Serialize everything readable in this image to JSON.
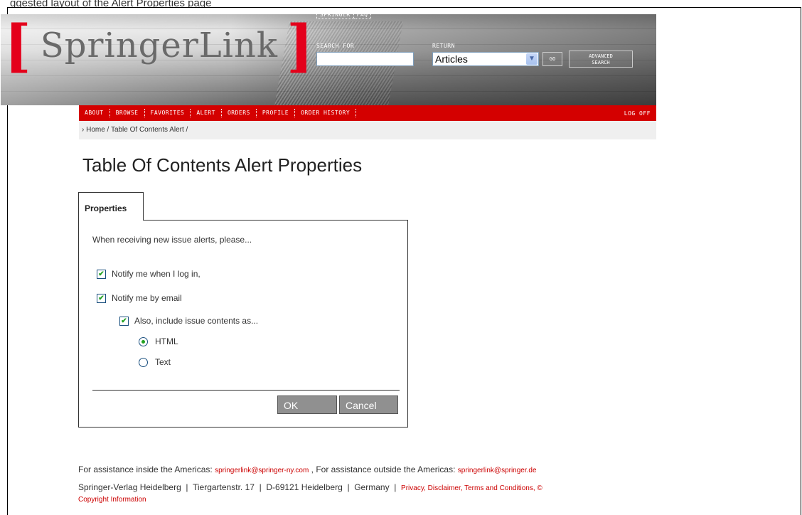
{
  "caption_fragment": "ggested layout of the Alert Properties page",
  "header": {
    "logo_text": "SpringerLink",
    "top_links": [
      "SPRINGER",
      "FAQ"
    ],
    "search_label": "SEARCH FOR",
    "search_value": "",
    "return_label": "RETURN",
    "return_selected": "Articles",
    "go_label": "GO",
    "advanced_line1": "ADVANCED",
    "advanced_line2": "SEARCH"
  },
  "nav": {
    "items": [
      "ABOUT",
      "BROWSE",
      "FAVORITES",
      "ALERT",
      "ORDERS",
      "PROFILE",
      "ORDER HISTORY"
    ],
    "logoff": "LOG OFF"
  },
  "breadcrumb": "› Home / Table Of Contents Alert /",
  "page_title": "Table Of Contents Alert Properties",
  "tab_label": "Properties",
  "form": {
    "intro": "When receiving new issue alerts, please...",
    "notify_login": "Notify me when I log in,",
    "notify_email": "Notify me by email",
    "include_contents": "Also, include issue contents as...",
    "format_html": "HTML",
    "format_text": "Text",
    "ok_label": "OK",
    "cancel_label": "Cancel",
    "notify_login_checked": true,
    "notify_email_checked": true,
    "include_contents_checked": true,
    "selected_format": "HTML"
  },
  "footer": {
    "assist_inside": "For assistance inside the Americas:",
    "email_us": "springerlink@springer-ny.com",
    "assist_outside": ", For assistance outside the Americas:",
    "email_de": "springerlink@springer.de",
    "address": "Springer-Verlag Heidelberg  |  Tiergartenstr. 17  |  D-69121 Heidelberg  |  Germany  |",
    "privacy_link": "Privacy, Disclaimer, Terms and Conditions, ©",
    "copyright_link": "Copyright Information"
  },
  "colors": {
    "brand_red": "#d40000",
    "check_green": "#21a121"
  }
}
